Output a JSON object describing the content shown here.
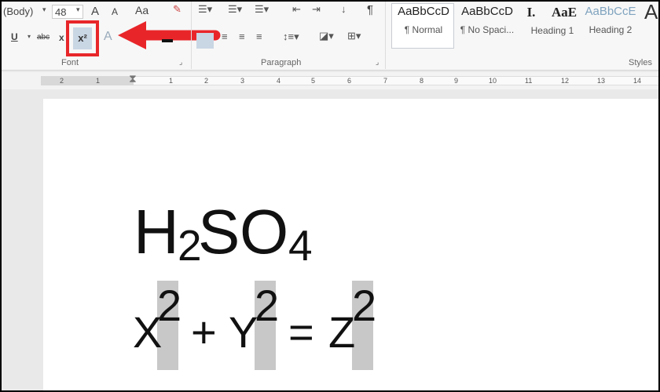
{
  "ribbon": {
    "font_name": "(Body)",
    "font_size": "48",
    "grow_font": "A",
    "shrink_font": "A",
    "change_case": "Aa",
    "underline": "U",
    "strikethrough": "abc",
    "subscript": "x",
    "superscript": "x²",
    "text_effects": "A",
    "pilcrow": "¶",
    "groups": {
      "font": "Font",
      "paragraph": "Paragraph",
      "styles": "Styles"
    },
    "styles": [
      {
        "preview": "AaBbCcD",
        "name": "¶ Normal"
      },
      {
        "preview": "AaBbCcD",
        "name": "¶ No Spaci..."
      },
      {
        "preview": "I.",
        "name": ""
      },
      {
        "preview": "AaE",
        "name": "Heading 1"
      },
      {
        "preview": "AaBbCcE",
        "name": "Heading 2"
      }
    ],
    "highlight_color": "#e8262a"
  },
  "ruler": {
    "numbers": [
      "2",
      "1",
      "1",
      "2",
      "3",
      "4",
      "5",
      "6",
      "7",
      "8",
      "9",
      "10",
      "11",
      "12",
      "13",
      "14"
    ]
  },
  "document": {
    "formula1": {
      "H": "H",
      "sub2": "2",
      "S": "S",
      "O": "O",
      "sub4": "4"
    },
    "formula2": {
      "X": "X",
      "supX": "2",
      "plus": "+",
      "Y": "Y",
      "supY": "2",
      "eq": "=",
      "Z": "Z",
      "supZ": "2"
    }
  }
}
